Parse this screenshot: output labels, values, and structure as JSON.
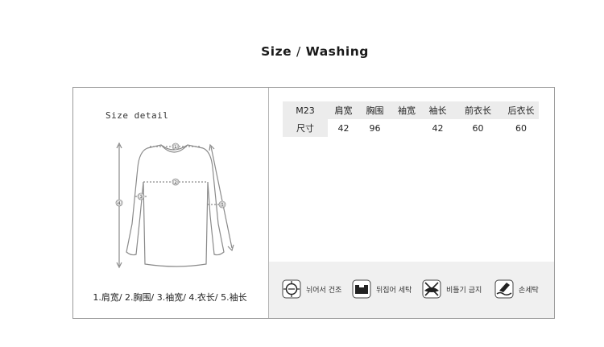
{
  "header": {
    "title_left": "Size",
    "title_sep": "/",
    "title_right": "Washing"
  },
  "size_detail": {
    "label": "Size detail",
    "figure_markers": [
      "①",
      "②",
      "③",
      "④",
      "⑤"
    ],
    "caption": "1.肩宽/ 2.胸围/ 3.袖宽/ 4.衣长/ 5.袖长"
  },
  "size_table": {
    "headers": [
      "M23",
      "肩宽",
      "胸围",
      "袖宽",
      "袖长",
      "前衣长",
      "后衣长"
    ],
    "rows": [
      [
        "尺寸",
        "42",
        "96",
        "",
        "42",
        "60",
        "60"
      ]
    ]
  },
  "washing": [
    {
      "icon": "dry-cleaning-icon",
      "label": "뉘어서 건조"
    },
    {
      "icon": "inside-out-wash-icon",
      "label": "뒤집어 세탁"
    },
    {
      "icon": "no-wringing-icon",
      "label": "비틀기 금지"
    },
    {
      "icon": "hand-wash-icon",
      "label": "손세탁"
    }
  ]
}
